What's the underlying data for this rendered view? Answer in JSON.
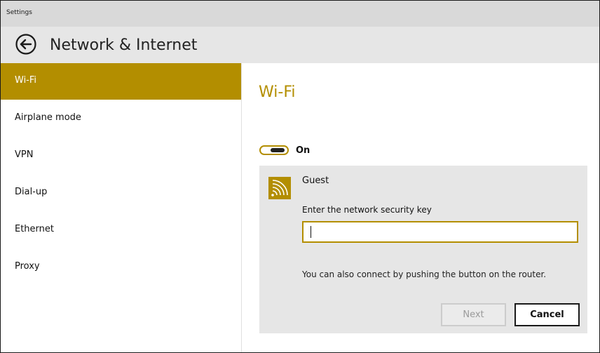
{
  "window": {
    "title": "Settings"
  },
  "header": {
    "title": "Network & Internet",
    "back_icon": "arrow-left-circle-icon"
  },
  "sidebar": {
    "items": [
      {
        "label": "Wi-Fi",
        "active": true
      },
      {
        "label": "Airplane mode",
        "active": false
      },
      {
        "label": "VPN",
        "active": false
      },
      {
        "label": "Dial-up",
        "active": false
      },
      {
        "label": "Ethernet",
        "active": false
      },
      {
        "label": "Proxy",
        "active": false
      }
    ]
  },
  "main": {
    "title": "Wi-Fi",
    "wifi_toggle": {
      "label": "On",
      "state": "on"
    },
    "network": {
      "name": "Guest",
      "icon": "wifi-signal-icon",
      "key_label": "Enter the network security key",
      "key_value": "",
      "hint": "You can also connect by pushing the button on the router.",
      "next_label": "Next",
      "cancel_label": "Cancel"
    }
  },
  "colors": {
    "accent": "#b38e00",
    "titlebar": "#d9d9d9",
    "header": "#e6e6e6",
    "card": "#e6e6e6"
  }
}
